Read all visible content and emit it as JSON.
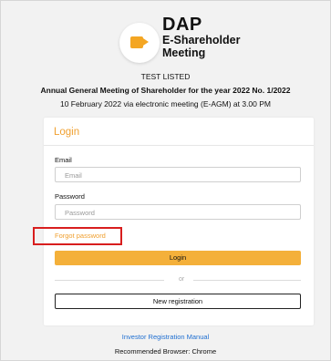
{
  "logo": {
    "line1": "DAP",
    "line2": "E-Shareholder",
    "line3": "Meeting",
    "icon": "video-camera-icon",
    "accent": "#f4a623"
  },
  "header": {
    "company": "TEST LISTED",
    "meeting": "Annual General Meeting of Shareholder for the year 2022 No. 1/2022",
    "date": "10 February 2022 via electronic meeting (E-AGM) at 3.00 PM"
  },
  "login": {
    "title": "Login",
    "email_label": "Email",
    "email_placeholder": "Email",
    "email_value": "",
    "password_label": "Password",
    "password_placeholder": "Password",
    "password_value": "",
    "forgot_label": "Forgot password",
    "login_button": "Login",
    "or_text": "or",
    "new_registration_button": "New registration"
  },
  "footer": {
    "manual_link": "Investor Registration Manual",
    "browser_note": "Recommended Browser: Chrome"
  },
  "colors": {
    "accent": "#f0a030",
    "login_button": "#f4b03a",
    "highlight": "#d81e1e",
    "link": "#1f6fd1"
  }
}
